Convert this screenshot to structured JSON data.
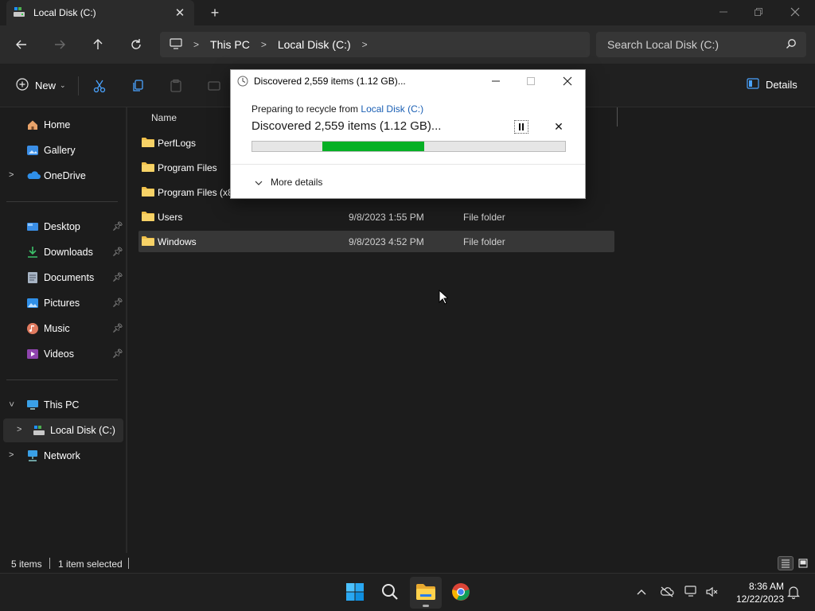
{
  "window": {
    "tab_title": "Local Disk (C:)",
    "new_tab_label": "+"
  },
  "address": {
    "crumbs": [
      "This PC",
      "Local Disk (C:)"
    ],
    "search_placeholder": "Search Local Disk (C:)"
  },
  "toolbar": {
    "new_label": "New",
    "details_label": "Details"
  },
  "sidebar": {
    "quick": [
      {
        "label": "Home",
        "icon": "home-icon"
      },
      {
        "label": "Gallery",
        "icon": "gallery-icon"
      },
      {
        "label": "OneDrive",
        "icon": "onedrive-icon"
      }
    ],
    "pinned": [
      {
        "label": "Desktop",
        "icon": "desktop-icon"
      },
      {
        "label": "Downloads",
        "icon": "downloads-icon"
      },
      {
        "label": "Documents",
        "icon": "documents-icon"
      },
      {
        "label": "Pictures",
        "icon": "pictures-icon"
      },
      {
        "label": "Music",
        "icon": "music-icon"
      },
      {
        "label": "Videos",
        "icon": "videos-icon"
      }
    ],
    "devices": [
      {
        "label": "This PC",
        "icon": "pc-icon"
      },
      {
        "label": "Local Disk (C:)",
        "icon": "drive-icon"
      },
      {
        "label": "Network",
        "icon": "network-icon"
      }
    ]
  },
  "filelist": {
    "columns": {
      "name": "Name"
    },
    "rows": [
      {
        "name": "PerfLogs",
        "date": "",
        "type": ""
      },
      {
        "name": "Program Files",
        "date": "",
        "type": ""
      },
      {
        "name": "Program Files (x86)",
        "date": "",
        "type": ""
      },
      {
        "name": "Users",
        "date": "9/8/2023 1:55 PM",
        "type": "File folder"
      },
      {
        "name": "Windows",
        "date": "9/8/2023 4:52 PM",
        "type": "File folder"
      }
    ]
  },
  "status": {
    "item_count": "5 items",
    "selection": "1 item selected"
  },
  "dialog": {
    "title": "Discovered 2,559 items (1.12 GB)...",
    "subtitle_prefix": "Preparing to recycle from ",
    "subtitle_link": "Local Disk (C:)",
    "headline": "Discovered 2,559 items (1.12 GB)...",
    "more_details": "More details",
    "progress_indeterminate": true
  },
  "taskbar": {
    "time": "8:36 AM",
    "date": "12/22/2023"
  },
  "colors": {
    "accent": "#0078d4",
    "progress": "#06b025",
    "link": "#1a5fb4"
  }
}
